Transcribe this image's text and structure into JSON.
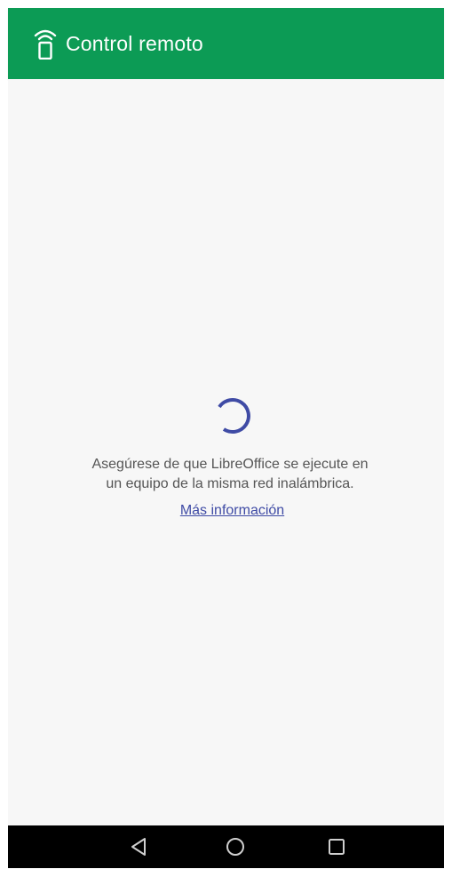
{
  "app_bar": {
    "title": "Control remoto",
    "icon": "remote-wifi-icon",
    "background_color": "#0c9b55"
  },
  "main": {
    "spinner": {
      "icon": "loading-spinner",
      "color": "#3f4ba5"
    },
    "message_line1": "Asegúrese de que LibreOffice se ejecute en",
    "message_line2": "un equipo de la misma red inalámbrica.",
    "more_info_link": "Más información",
    "link_color": "#3f4ba5"
  },
  "nav_bar": {
    "buttons": [
      "back-icon",
      "home-icon",
      "recents-icon"
    ],
    "background_color": "#000000"
  }
}
